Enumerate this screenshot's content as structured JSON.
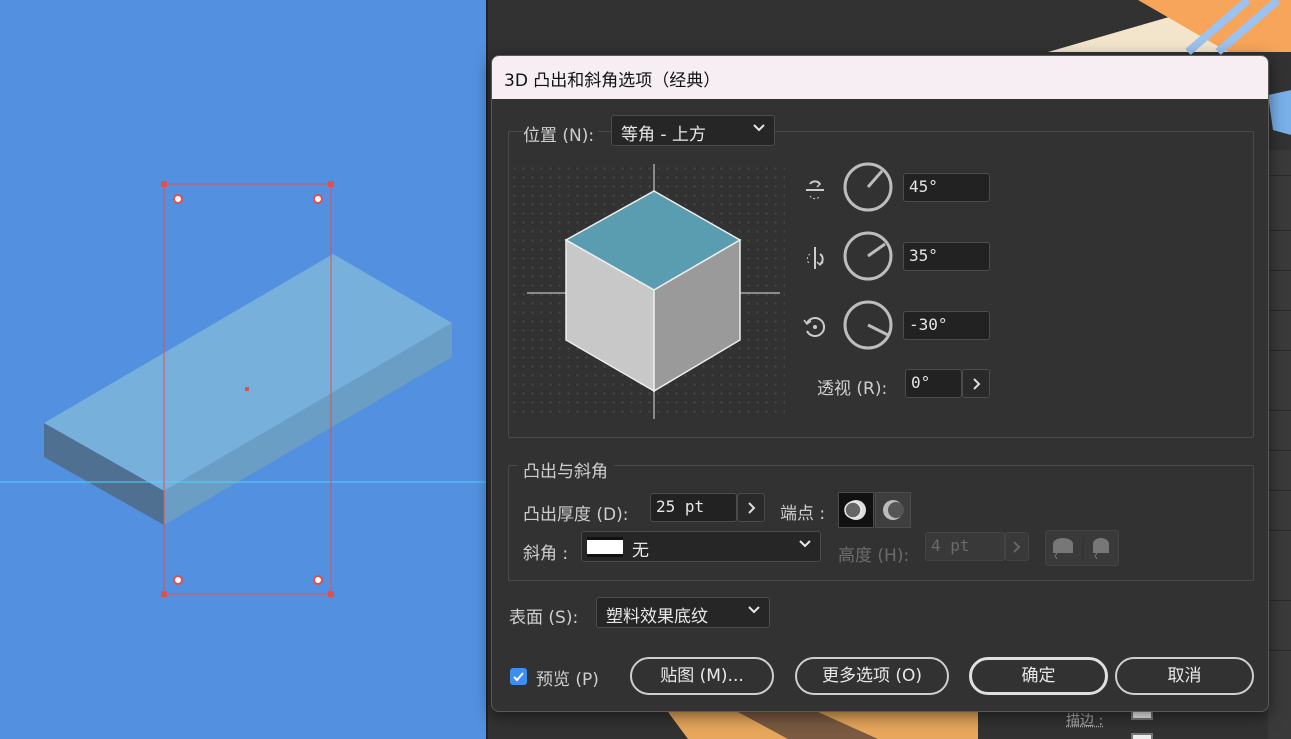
{
  "dialog": {
    "title": "3D 凸出和斜角选项（经典）",
    "position": {
      "label": "位置 (N):",
      "value": "等角 - 上方"
    },
    "rotation": {
      "x": {
        "icon": "rotate-x-axis-icon",
        "value": "45°"
      },
      "y": {
        "icon": "rotate-y-axis-icon",
        "value": "35°"
      },
      "z": {
        "icon": "rotate-z-axis-icon",
        "value": "-30°"
      }
    },
    "perspective": {
      "label": "透视 (R):",
      "value": "0°"
    },
    "extrude_group": {
      "title": "凸出与斜角",
      "depth_label": "凸出厚度 (D):",
      "depth_value": "25 pt",
      "cap_label": "端点 :",
      "bevel_label": "斜角 :",
      "bevel_value": "无",
      "height_label": "高度 (H):",
      "height_value": "4 pt"
    },
    "surface": {
      "label": "表面 (S):",
      "value": "塑料效果底纹"
    },
    "preview": {
      "label": "预览 (P)",
      "checked": true
    },
    "buttons": {
      "map": "贴图 (M)...",
      "more": "更多选项 (O)",
      "ok": "确定",
      "cancel": "取消"
    }
  },
  "background": {
    "stroke_label": "描边 :"
  },
  "colors": {
    "canvas": "#5390e0",
    "cube_top": "#5a9db0",
    "cube_left": "#c8c8c8",
    "cube_right": "#9a9a9a",
    "accent": "#3d8ef0",
    "selection": "#e05050"
  }
}
